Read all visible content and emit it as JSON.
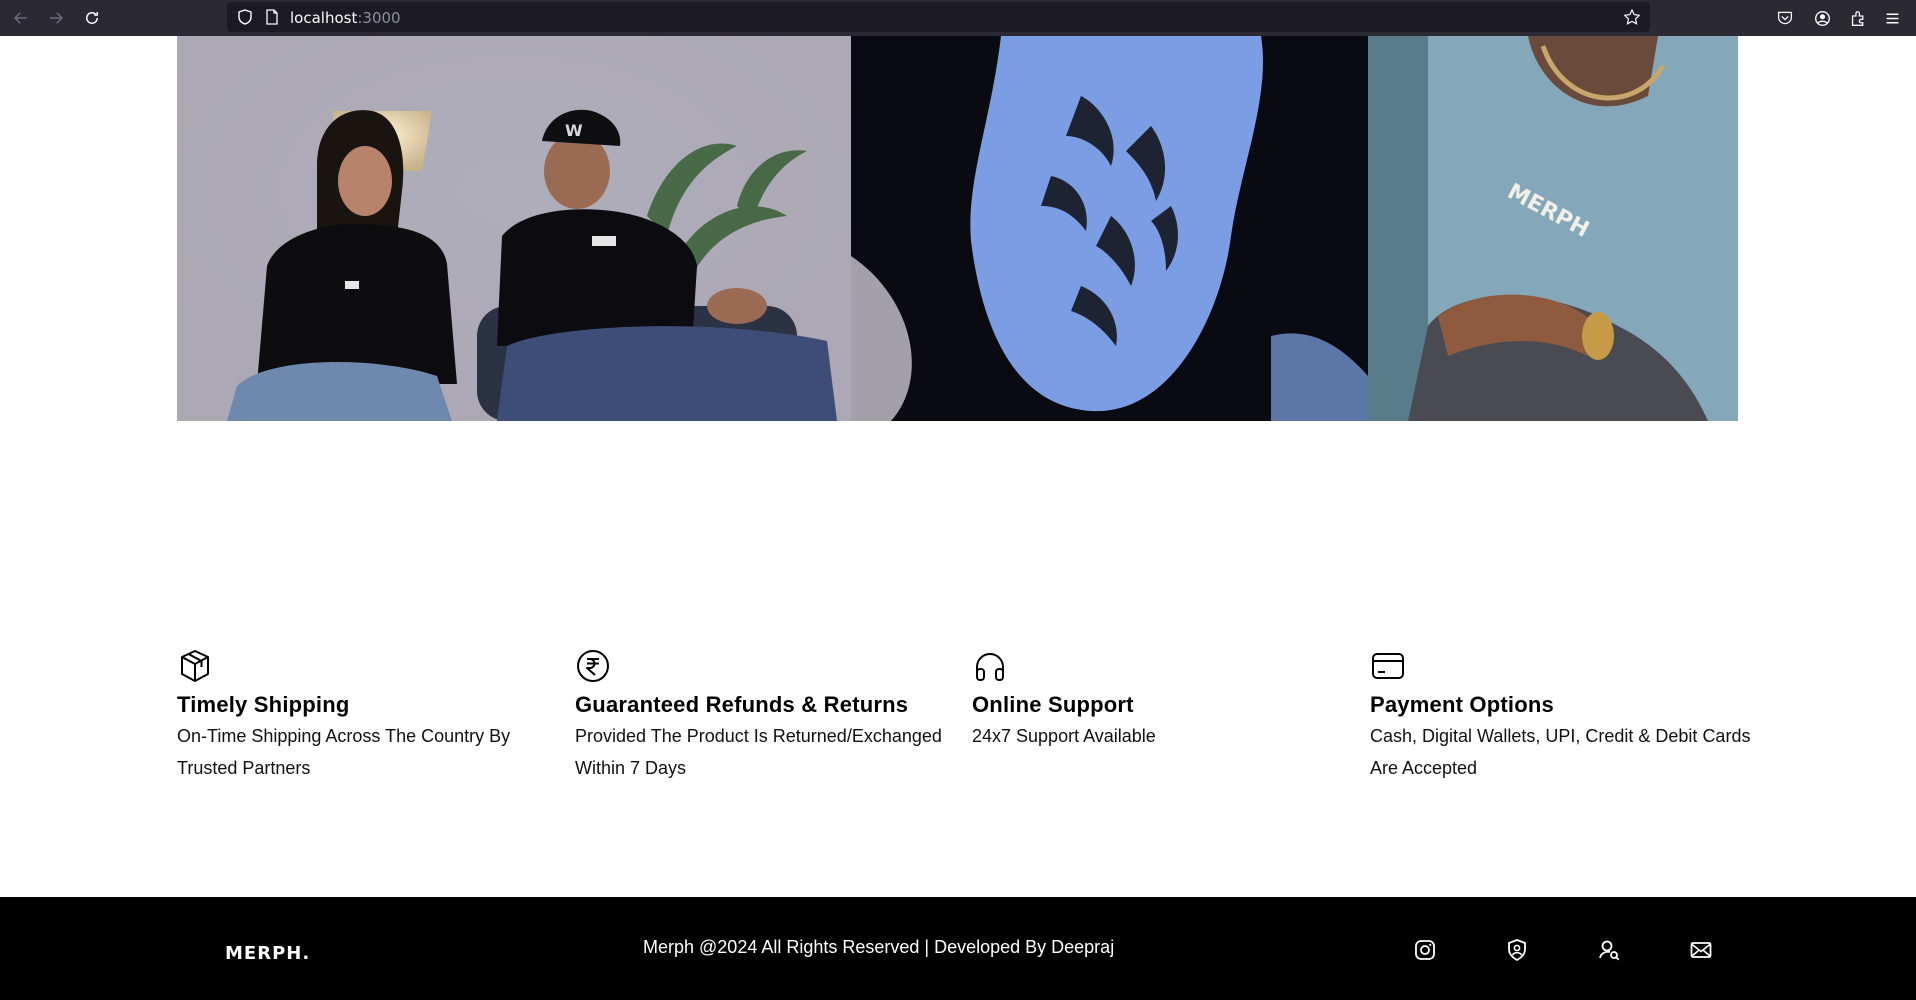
{
  "browser": {
    "url_host": "localhost",
    "url_port": ":3000"
  },
  "hero": {
    "photo_1_shirt_text": "MERPH",
    "photo_3_shirt_text": "MERPH"
  },
  "features": [
    {
      "icon": "box-icon",
      "title": "Timely Shipping",
      "description": "On-Time Shipping Across The Country By Trusted Partners"
    },
    {
      "icon": "rupee-icon",
      "title": "Guaranteed Refunds & Returns",
      "description": "Provided The Product Is Returned/Exchanged Within 7 Days"
    },
    {
      "icon": "headphones-icon",
      "title": "Online Support",
      "description": "24x7 Support Available"
    },
    {
      "icon": "credit-card-icon",
      "title": "Payment Options",
      "description": "Cash, Digital Wallets, UPI, Credit & Debit Cards Are Accepted"
    }
  ],
  "footer": {
    "brand": "MERPH.",
    "copyright": "Merph @2024 All Rights Reserved | Developed By Deepraj",
    "social_icons": [
      "instagram-icon",
      "user-shield-icon",
      "user-search-icon",
      "mail-icon"
    ]
  },
  "colors": {
    "chrome_bg": "#2b2a33",
    "footer_bg": "#000000",
    "text": "#000000"
  }
}
